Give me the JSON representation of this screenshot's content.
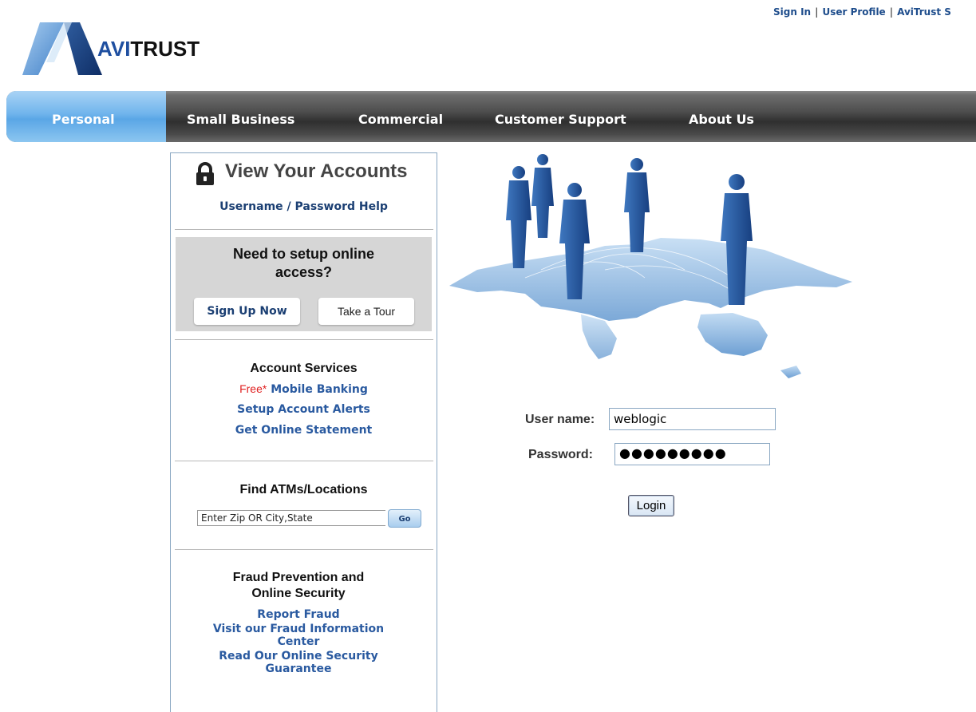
{
  "top_links": [
    "Sign In",
    "User Profile",
    "AviTrust S"
  ],
  "brand": {
    "prefix": "AVI",
    "suffix": "TRUST"
  },
  "nav": {
    "items": [
      "Personal",
      "Small Business",
      "Commercial",
      "Customer Support",
      "About Us"
    ],
    "active": "Personal"
  },
  "accounts": {
    "title": "View Your Accounts",
    "help_link": "Username / Password Help",
    "setup_prompt": "Need to setup online access?",
    "signup_label": "Sign Up Now",
    "tour_label": "Take a Tour"
  },
  "services": {
    "title": "Account Services",
    "free_tag": "Free*",
    "links": [
      "Mobile Banking",
      "Setup Account Alerts",
      "Get Online Statement"
    ]
  },
  "atm": {
    "title": "Find ATMs/Locations",
    "input_value": "Enter Zip OR City,State",
    "go_label": "Go"
  },
  "fraud": {
    "title_line1": "Fraud Prevention and",
    "title_line2": "Online Security",
    "links": [
      "Report Fraud",
      "Visit our Fraud Information Center",
      "Read Our Online Security Guarantee"
    ]
  },
  "login": {
    "username_label": "User name:",
    "username_value": "weblogic",
    "password_label": "Password:",
    "password_value": "●●●●●●●●●",
    "submit_label": "Login"
  },
  "colors": {
    "brand_blue": "#1f4fa0",
    "link_blue": "#2a5aa0",
    "nav_active": "#6fb4ec",
    "nav_dark": "#3a3a3a",
    "free_red": "#e02020"
  },
  "icons": [
    "lock-icon",
    "logo-mark",
    "hero-world-map-people"
  ]
}
